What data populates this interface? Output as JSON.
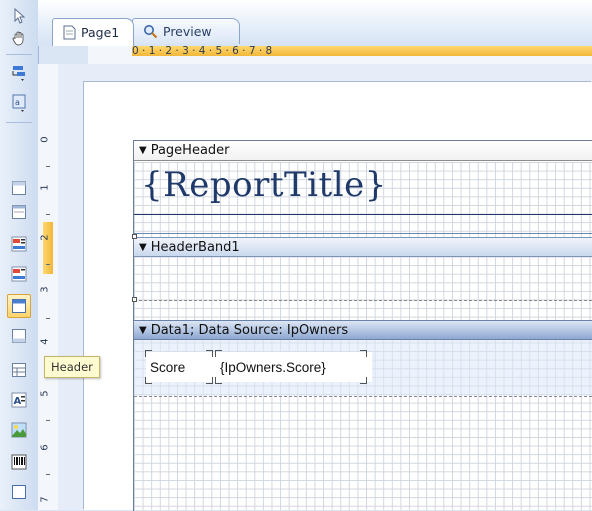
{
  "tabs": [
    {
      "label": "Page1",
      "icon": "page-icon",
      "active": true
    },
    {
      "label": "Preview",
      "icon": "magnifier-icon",
      "active": false
    }
  ],
  "ruler": {
    "horizontal_marks": "0 · 1 · 2 · 3 · 4 · 5 · 6 · 7 · 8",
    "vertical_marks": [
      "0",
      "1",
      "2",
      "3",
      "4",
      "5",
      "6",
      "7"
    ]
  },
  "bands": {
    "page_header": "PageHeader",
    "header_band": "HeaderBand1",
    "data_band": "Data1; Data Source: IpOwners"
  },
  "report": {
    "title_expression": "{ReportTitle}",
    "score_label": "Score",
    "score_expression": "{IpOwners.Score}"
  },
  "tooltip": {
    "text": "Header"
  },
  "toolbar": {
    "tools": [
      "select-pointer-icon",
      "pan-hand-icon",
      "add-page-icon",
      "add-form-icon",
      "report-title-band-icon",
      "page-header-band-icon",
      "header-band-icon",
      "group-header-band-icon",
      "data-band-icon",
      "footer-band-icon",
      "text-component-icon",
      "image-component-icon",
      "barcode-component-icon",
      "panel-component-icon"
    ],
    "selected_tool": "data-band-icon"
  },
  "colors": {
    "accent": "#f2b73a",
    "title": "#1f3a6a",
    "data_band": "#8ea8d2"
  }
}
